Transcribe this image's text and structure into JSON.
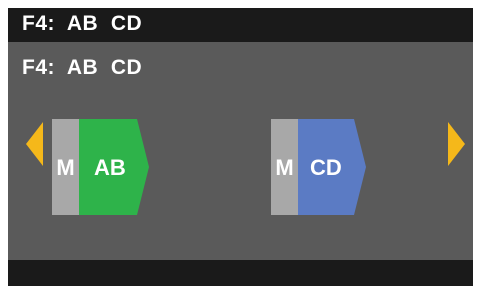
{
  "header": {
    "title": "F4:  AB  CD"
  },
  "main": {
    "subtitle": "F4:  AB  CD",
    "blocks": [
      {
        "mode": "M",
        "label": "AB",
        "color": "#2eb34a"
      },
      {
        "mode": "M",
        "label": "CD",
        "color": "#5b7bc4"
      }
    ]
  },
  "navigation": {
    "prev_icon": "triangle-left-icon",
    "next_icon": "triangle-right-icon",
    "arrow_color": "#f5b81a"
  },
  "colors": {
    "background": "#5a5a5a",
    "bars": "#1a1a1a",
    "mode_box": "#a8a8a8"
  }
}
